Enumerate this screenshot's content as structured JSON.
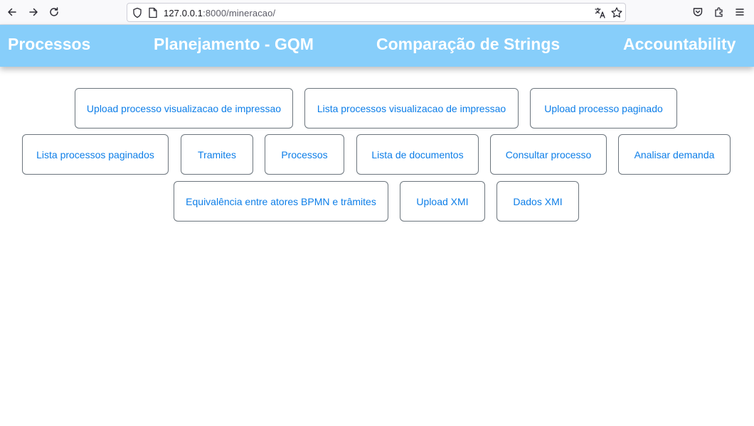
{
  "browser": {
    "url_host": "127.0.0.1",
    "url_path": ":8000/mineracao/",
    "icons": [
      "back-arrow-icon",
      "forward-arrow-icon",
      "reload-icon",
      "shield-icon",
      "page-icon",
      "translate-icon",
      "star-icon",
      "pocket-icon",
      "extensions-icon",
      "menu-icon"
    ]
  },
  "nav": {
    "items": [
      {
        "label": "Processos"
      },
      {
        "label": "Planejamento - GQM"
      },
      {
        "label": "Comparação de Strings"
      },
      {
        "label": "Accountability"
      }
    ],
    "background": "#87cefa",
    "text_color": "#ffffff"
  },
  "buttons": {
    "row1": [
      {
        "label": "Upload processo visualizacao de impressao"
      },
      {
        "label": "Lista processos visualizacao de impressao"
      },
      {
        "label": "Upload processo paginado"
      }
    ],
    "row2": [
      {
        "label": "Lista processos paginados"
      },
      {
        "label": "Tramites"
      },
      {
        "label": "Processos"
      },
      {
        "label": "Lista de documentos"
      },
      {
        "label": "Consultar processo"
      },
      {
        "label": "Analisar demanda"
      }
    ],
    "row3": [
      {
        "label": "Equivalência entre atores BPMN e trâmites"
      },
      {
        "label": "Upload XMI"
      },
      {
        "label": "Dados XMI"
      }
    ],
    "text_color": "#0d7ee8",
    "border_color": "#6c757d"
  }
}
